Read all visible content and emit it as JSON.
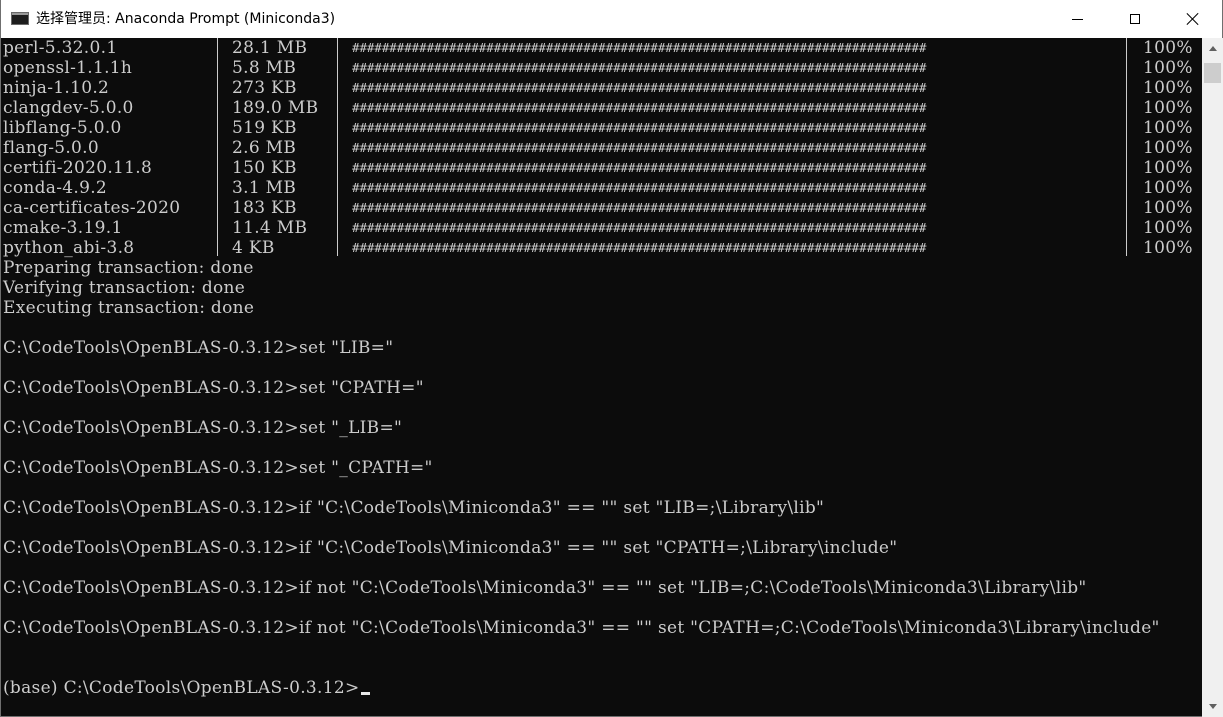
{
  "window": {
    "title": "选择管理员: Anaconda Prompt (Miniconda3)"
  },
  "packages": [
    {
      "name": "perl-5.32.0.1",
      "size": "28.1 MB",
      "bar": "#############################################################################",
      "percent": "100%"
    },
    {
      "name": "openssl-1.1.1h",
      "size": "5.8 MB",
      "bar": "#############################################################################",
      "percent": "100%"
    },
    {
      "name": "ninja-1.10.2",
      "size": "273 KB",
      "bar": "#############################################################################",
      "percent": "100%"
    },
    {
      "name": "clangdev-5.0.0",
      "size": "189.0 MB",
      "bar": "#############################################################################",
      "percent": "100%"
    },
    {
      "name": "libflang-5.0.0",
      "size": "519 KB",
      "bar": "#############################################################################",
      "percent": "100%"
    },
    {
      "name": "flang-5.0.0",
      "size": "2.6 MB",
      "bar": "#############################################################################",
      "percent": "100%"
    },
    {
      "name": "certifi-2020.11.8",
      "size": "150 KB",
      "bar": "#############################################################################",
      "percent": "100%"
    },
    {
      "name": "conda-4.9.2",
      "size": "3.1 MB",
      "bar": "#############################################################################",
      "percent": "100%"
    },
    {
      "name": "ca-certificates-2020",
      "size": "183 KB",
      "bar": "#############################################################################",
      "percent": "100%"
    },
    {
      "name": "cmake-3.19.1",
      "size": "11.4 MB",
      "bar": "#############################################################################",
      "percent": "100%"
    },
    {
      "name": "python_abi-3.8",
      "size": "4 KB",
      "bar": "#############################################################################",
      "percent": "100%"
    }
  ],
  "status_lines": [
    "Preparing transaction: done",
    "Verifying transaction: done",
    "Executing transaction: done"
  ],
  "commands": [
    "C:\\CodeTools\\OpenBLAS-0.3.12>set \"LIB=\"",
    "C:\\CodeTools\\OpenBLAS-0.3.12>set \"CPATH=\"",
    "C:\\CodeTools\\OpenBLAS-0.3.12>set \"_LIB=\"",
    "C:\\CodeTools\\OpenBLAS-0.3.12>set \"_CPATH=\"",
    "C:\\CodeTools\\OpenBLAS-0.3.12>if \"C:\\CodeTools\\Miniconda3\" == \"\" set \"LIB=;\\Library\\lib\"",
    "C:\\CodeTools\\OpenBLAS-0.3.12>if \"C:\\CodeTools\\Miniconda3\" == \"\" set \"CPATH=;\\Library\\include\"",
    "C:\\CodeTools\\OpenBLAS-0.3.12>if not \"C:\\CodeTools\\Miniconda3\" == \"\" set \"LIB=;C:\\CodeTools\\Miniconda3\\Library\\lib\"",
    "C:\\CodeTools\\OpenBLAS-0.3.12>if not \"C:\\CodeTools\\Miniconda3\" == \"\" set \"CPATH=;C:\\CodeTools\\Miniconda3\\Library\\include\""
  ],
  "prompt": "(base) C:\\CodeTools\\OpenBLAS-0.3.12>",
  "colors": {
    "console_bg": "#0c0c0c",
    "console_fg": "#cccccc",
    "titlebar_bg": "#ffffff",
    "scrollbar_bg": "#f0f0f0"
  },
  "icons": {
    "app": "console-icon",
    "minimize": "minimize-icon",
    "maximize": "maximize-icon",
    "close": "close-icon",
    "scroll_up": "chevron-up-icon",
    "scroll_down": "chevron-down-icon"
  }
}
